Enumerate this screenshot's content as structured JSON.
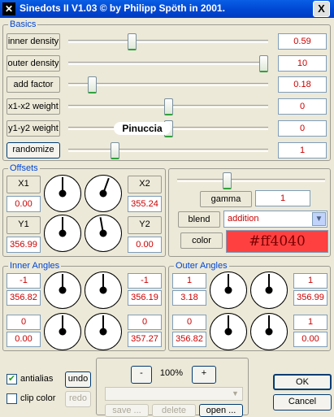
{
  "window": {
    "title": "Sinedots II V1.03 © by Philipp Spöth in 2001.",
    "icon": "app-icon",
    "close_label": "X"
  },
  "basics": {
    "label": "Basics",
    "rows": [
      {
        "label": "inner density",
        "value": "0.59",
        "level": 0.31
      },
      {
        "label": "outer density",
        "value": "10",
        "level": 1.0
      },
      {
        "label": "add factor",
        "value": "0.18",
        "level": 0.1
      },
      {
        "label": "x1-x2 weight",
        "value": "0",
        "level": 0.5
      },
      {
        "label": "y1-y2 weight",
        "value": "0",
        "level": 0.5
      },
      {
        "label": "randomize",
        "value": "1",
        "level": 0.22
      }
    ],
    "watermark": "Pinuccia"
  },
  "offsets": {
    "label": "Offsets",
    "x1_label": "X1",
    "x1_value": "0.00",
    "x2_label": "X2",
    "x2_value": "355.24",
    "y1_label": "Y1",
    "y1_value": "356.99",
    "y2_label": "Y2",
    "y2_value": "0.00"
  },
  "render": {
    "gamma_label": "gamma",
    "gamma_value": "1",
    "gamma_level": 0.33,
    "blend_label": "blend",
    "blend_value": "addition",
    "color_label": "color",
    "color_value": "#ff4040"
  },
  "inner_angles": {
    "label": "Inner Angles",
    "values": [
      "-1",
      "356.82",
      "-1",
      "356.19",
      "0",
      "0.00",
      "0",
      "357.27"
    ]
  },
  "outer_angles": {
    "label": "Outer Angles",
    "values": [
      "1",
      "3.18",
      "1",
      "356.99",
      "0",
      "356.82",
      "1",
      "0.00"
    ]
  },
  "options": {
    "antialias_label": "antialias",
    "antialias_checked": "✔",
    "clip_label": "clip color"
  },
  "history": {
    "undo": "undo",
    "redo": "redo"
  },
  "zoom": {
    "minus": "-",
    "value": "100%",
    "plus": "+"
  },
  "files": {
    "save": "save ...",
    "delete": "delete",
    "open": "open ..."
  },
  "dialog": {
    "ok": "OK",
    "cancel": "Cancel"
  },
  "colors": {
    "titlebar": "#0054e3",
    "accent": "#0046d5",
    "value_text": "#cc0000",
    "swatch": "#ff4040"
  }
}
